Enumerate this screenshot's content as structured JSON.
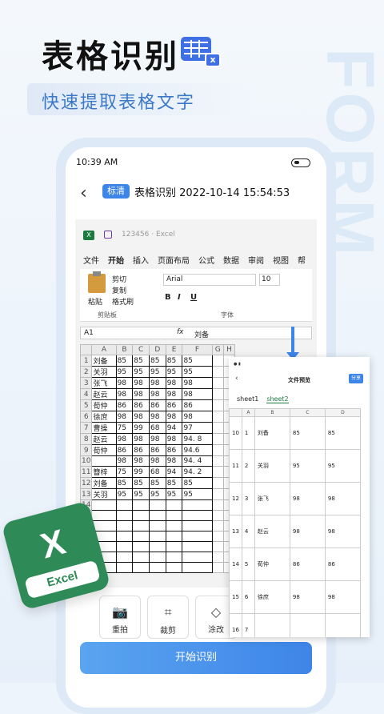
{
  "header": {
    "title": "表格识别",
    "subtitle": "快速提取表格文字",
    "bg_word": "FORM",
    "icon_badge": "x"
  },
  "phone": {
    "time": "10:39 AM",
    "badge": "标清",
    "nav_title": "表格识别 2022-10-14 15:54:53"
  },
  "excel_app": {
    "file_name": "123456 · Excel",
    "menu": [
      "文件",
      "开始",
      "插入",
      "页面布局",
      "公式",
      "数据",
      "审阅",
      "视图",
      "帮"
    ],
    "ribbon": {
      "paste": "粘贴",
      "cut": "剪切",
      "copy": "复制",
      "format_painter": "格式刷",
      "clipboard_group": "剪贴板",
      "font_name": "Arial",
      "font_size": "10",
      "bold": "B",
      "italic": "I",
      "underline": "U",
      "font_group": "字体"
    },
    "cell_ref": "A1",
    "fx": "fx",
    "formula_value": "刘备",
    "columns": [
      "A",
      "B",
      "C",
      "D",
      "E",
      "F",
      "G",
      "H"
    ],
    "rows": [
      {
        "n": "1",
        "name": "刘备",
        "v": [
          "85",
          "85",
          "85",
          "85",
          "85"
        ]
      },
      {
        "n": "2",
        "name": "关羽",
        "v": [
          "95",
          "95",
          "95",
          "95",
          "95"
        ]
      },
      {
        "n": "3",
        "name": "张飞",
        "v": [
          "98",
          "98",
          "98",
          "98",
          "98"
        ]
      },
      {
        "n": "4",
        "name": "赵云",
        "v": [
          "98",
          "98",
          "98",
          "98",
          "98"
        ]
      },
      {
        "n": "5",
        "name": "荀仲",
        "v": [
          "86",
          "86",
          "86",
          "86",
          "86"
        ]
      },
      {
        "n": "6",
        "name": "徐庶",
        "v": [
          "98",
          "98",
          "98",
          "98",
          "98"
        ]
      },
      {
        "n": "7",
        "name": "曹操",
        "v": [
          "75",
          "99",
          "68",
          "94",
          "97"
        ]
      },
      {
        "n": "8",
        "name": "赵云",
        "v": [
          "98",
          "98",
          "98",
          "98",
          "94. 8"
        ]
      },
      {
        "n": "9",
        "name": "荀仲",
        "v": [
          "86",
          "86",
          "86",
          "86",
          "94.6"
        ]
      },
      {
        "n": "10",
        "name": "",
        "v": [
          "98",
          "98",
          "98",
          "98",
          "94. 4"
        ]
      },
      {
        "n": "11",
        "name": "簪梓",
        "v": [
          "75",
          "99",
          "68",
          "94",
          "94. 2"
        ]
      },
      {
        "n": "12",
        "name": "刘备",
        "v": [
          "85",
          "85",
          "85",
          "85",
          "85"
        ]
      },
      {
        "n": "13",
        "name": "关羽",
        "v": [
          "95",
          "95",
          "95",
          "95",
          "95"
        ]
      },
      {
        "n": "14",
        "name": "",
        "v": [
          "",
          "",
          "",
          "",
          ""
        ]
      },
      {
        "n": "15",
        "name": "",
        "v": [
          "",
          "",
          "",
          "",
          ""
        ]
      },
      {
        "n": "16",
        "name": "",
        "v": [
          "",
          "",
          "",
          "",
          ""
        ]
      },
      {
        "n": "17",
        "name": "",
        "v": [
          "",
          "",
          "",
          "",
          ""
        ]
      },
      {
        "n": "18",
        "name": "",
        "v": [
          "",
          "",
          "",
          "",
          ""
        ]
      },
      {
        "n": "19",
        "name": "",
        "v": [
          "",
          "",
          "",
          "",
          ""
        ]
      },
      {
        "n": "20",
        "name": "",
        "v": [
          "",
          "",
          "",
          "",
          ""
        ]
      }
    ]
  },
  "preview": {
    "title": "文件预览",
    "share": "分享",
    "tabs": [
      "sheet1",
      "sheet2"
    ],
    "cols": [
      "A",
      "B",
      "C",
      "D"
    ],
    "rows": [
      {
        "r": "10",
        "a": "1",
        "b": "刘备",
        "c": "85",
        "d": "85"
      },
      {
        "r": "11",
        "a": "2",
        "b": "关羽",
        "c": "95",
        "d": "95"
      },
      {
        "r": "12",
        "a": "3",
        "b": "张飞",
        "c": "98",
        "d": "98"
      },
      {
        "r": "13",
        "a": "4",
        "b": "赵云",
        "c": "98",
        "d": "98"
      },
      {
        "r": "14",
        "a": "5",
        "b": "荀仲",
        "c": "86",
        "d": "86"
      },
      {
        "r": "15",
        "a": "6",
        "b": "徐庶",
        "c": "98",
        "d": "98"
      },
      {
        "r": "16",
        "a": "7",
        "b": "",
        "c": "",
        "d": ""
      }
    ]
  },
  "tools": [
    {
      "label": "重拍",
      "icon": "camera-icon",
      "glyph": "📷"
    },
    {
      "label": "裁剪",
      "icon": "crop-icon",
      "glyph": "⌗"
    },
    {
      "label": "涂改",
      "icon": "eraser-icon",
      "glyph": "◇"
    }
  ],
  "start_button": "开始识别",
  "excel_logo": {
    "letter": "X",
    "label": "Excel"
  }
}
